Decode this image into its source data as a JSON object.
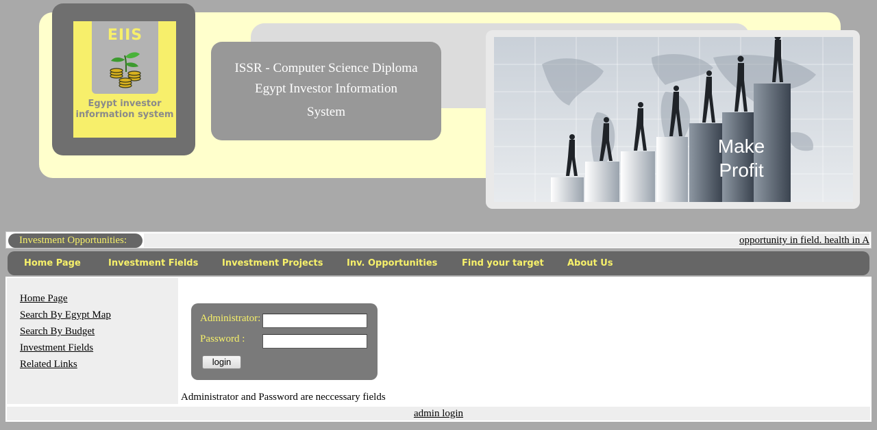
{
  "header": {
    "logo": {
      "abbr": "EIIS",
      "name": "Egypt investor information system"
    },
    "title_lines": [
      "ISSR - Computer Science Diploma",
      "Egypt Investor Information",
      "System"
    ],
    "hero_text": "Make Profit",
    "hero_lines": [
      "Make",
      "Profit"
    ]
  },
  "ticker": {
    "label": "Investment Opportunities:",
    "text": "opportunity in field. health in Alex"
  },
  "nav": {
    "items": [
      {
        "label": "Home Page"
      },
      {
        "label": "Investment Fields"
      },
      {
        "label": "Investment Projects"
      },
      {
        "label": "Inv. Opportunities"
      },
      {
        "label": "Find your target"
      },
      {
        "label": "About Us"
      }
    ]
  },
  "sidebar": {
    "links": [
      {
        "label": "Home Page"
      },
      {
        "label": "Search By Egypt Map"
      },
      {
        "label": "Search By Budget"
      },
      {
        "label": "Investment Fields"
      },
      {
        "label": "Related Links"
      }
    ]
  },
  "login": {
    "admin_label": "Administrator:",
    "admin_value": "",
    "password_label": "Password :",
    "password_value": "",
    "button_label": "login",
    "note": "Administrator and Password are neccessary fields"
  },
  "footer": {
    "link": "admin login"
  },
  "colors": {
    "page_bg": "#a9a9a9",
    "banner": "#ffffcc",
    "accent_yellow": "#f7f16a",
    "panel_grey": "#666666",
    "light_grey": "#eeeeee"
  }
}
